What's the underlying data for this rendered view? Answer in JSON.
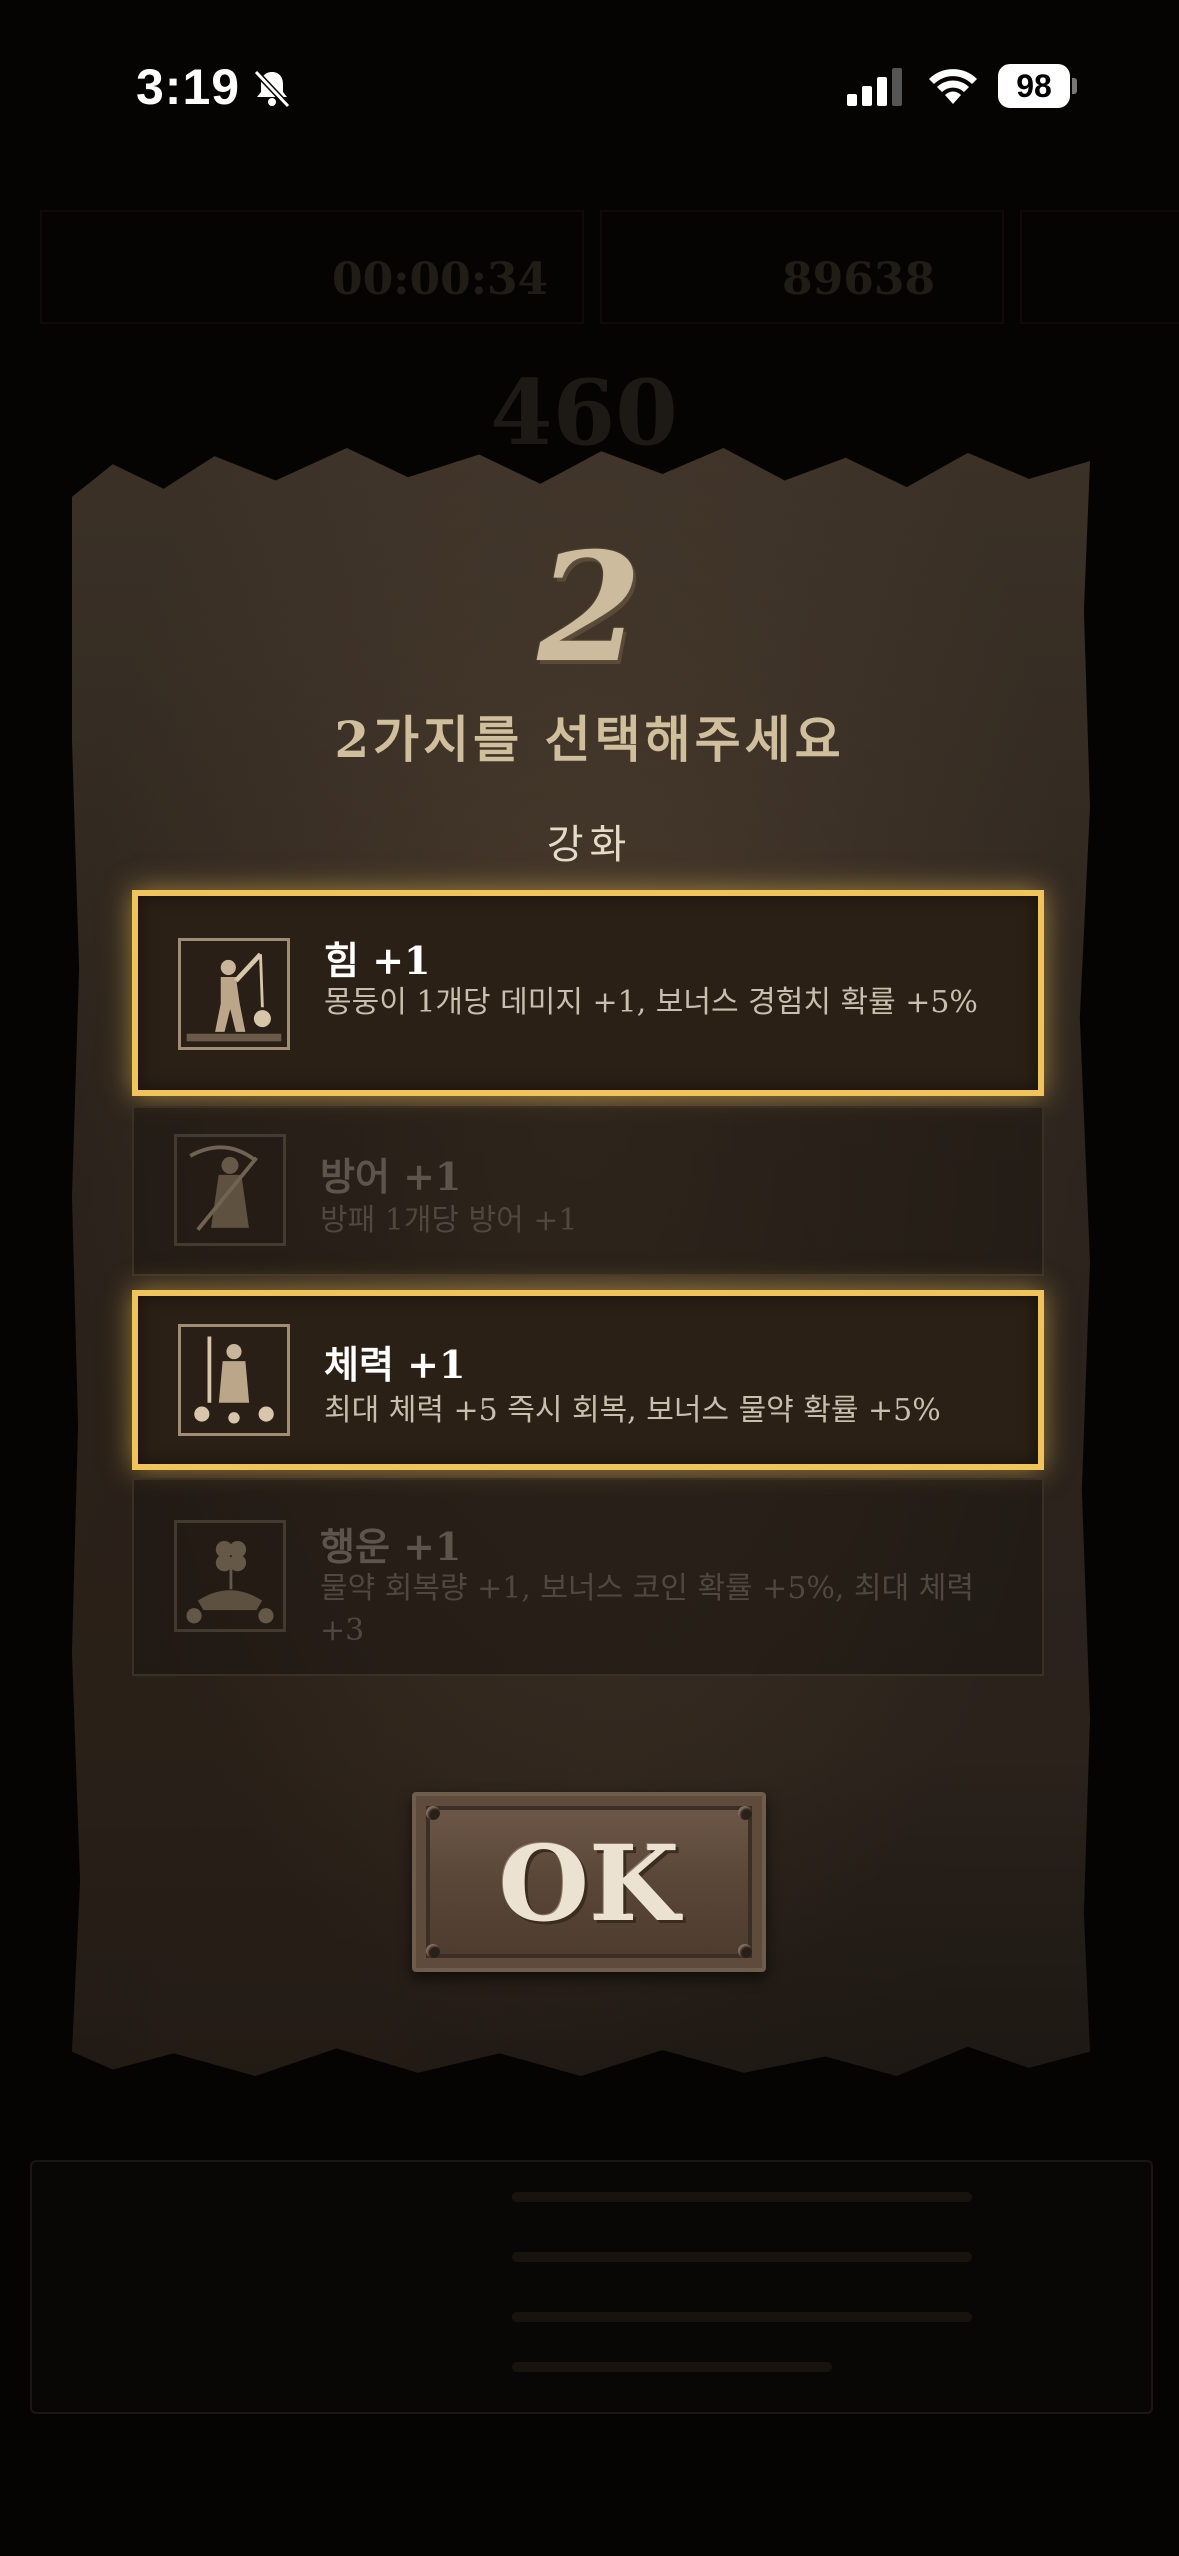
{
  "status_bar": {
    "time": "3:19",
    "battery": "98",
    "icons": [
      "bell-slash-icon",
      "signal-icon",
      "wifi-icon",
      "battery-icon"
    ]
  },
  "background_hud": {
    "timer": "00:00:34",
    "gold": "89638",
    "score": "460"
  },
  "dialog": {
    "count_numeral": "2",
    "title": "2가지를 선택해주세요",
    "section_label": "강화",
    "options": [
      {
        "name": "힘 +1",
        "description": "몽둥이 1개당 데미지 +1, 보너스 경험치 확률 +5%",
        "icon": "warrior-with-club-icon",
        "state": "selected"
      },
      {
        "name": "방어 +1",
        "description": "방패 1개당 방어 +1",
        "icon": "reaper-with-scythe-icon",
        "state": "disabled"
      },
      {
        "name": "체력 +1",
        "description": "최대 체력 +5 즉시 회복, 보너스 물약 확률 +5%",
        "icon": "knight-with-skulls-icon",
        "state": "selected"
      },
      {
        "name": "행운 +1",
        "description": "물약 회복량 +1, 보너스 코인 확률 +5%, 최대 체력 +3",
        "icon": "clover-in-hand-icon",
        "state": "disabled"
      }
    ],
    "ok_label": "OK"
  },
  "colors": {
    "selection_border": "#f0c45a",
    "parchment": "#2c241d",
    "background": "#050403"
  }
}
